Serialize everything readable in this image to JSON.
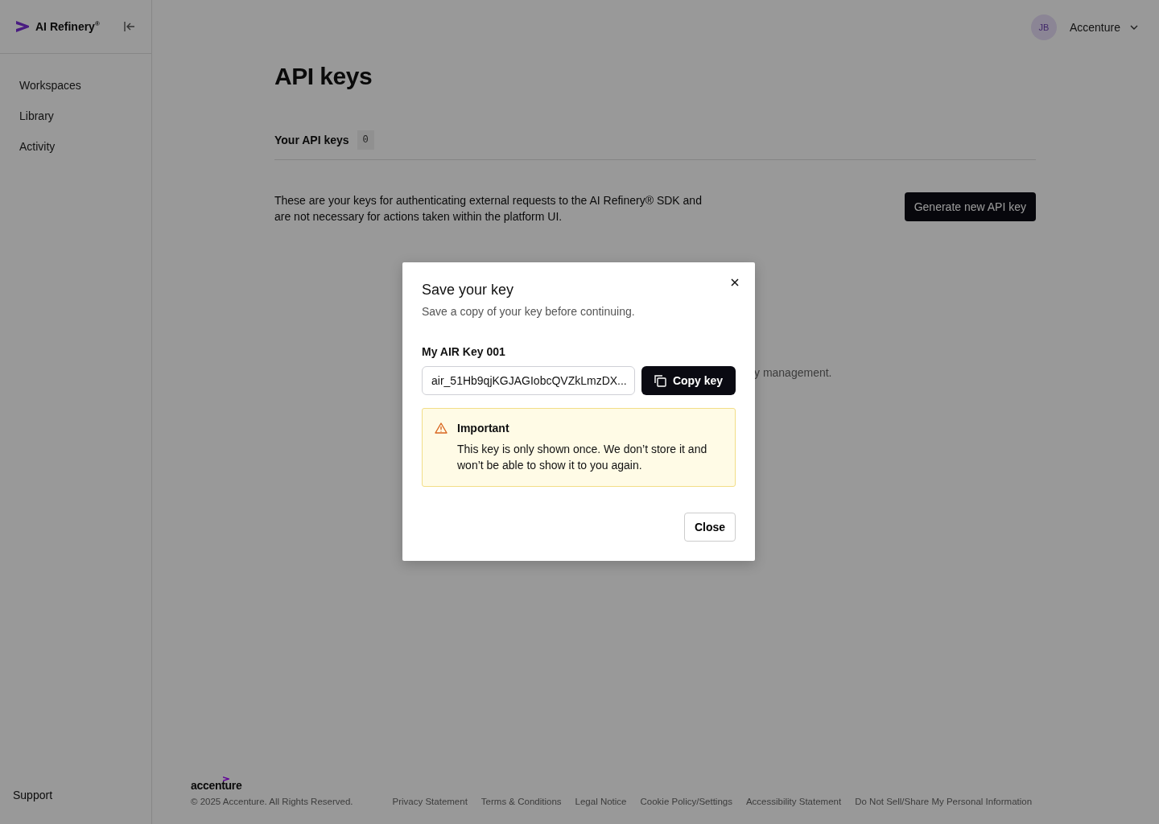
{
  "app": {
    "name": "AI Refinery$^{®}$"
  },
  "sidebar": {
    "items": [
      {
        "label": "Workspaces"
      },
      {
        "label": "Library"
      },
      {
        "label": "Activity"
      }
    ],
    "footer_item": "Support"
  },
  "header": {
    "avatar": "JB",
    "account": "Accenture"
  },
  "page": {
    "title": "API keys",
    "tabs": [
      {
        "label": "Your API keys",
        "count": "0",
        "selected": true
      }
    ],
    "description": "These are your keys for authenticating external requests to the AI Refinery® SDK and are not necessary for actions taken within the platform UI.",
    "generate_button": "Generate new API key",
    "background_text": "y management."
  },
  "modal": {
    "title": "Save your key",
    "subtitle": "Save a copy of your key before continuing.",
    "key_name": "My AIR Key 001",
    "key_value": "air_51Hb9qjKGJAGIobcQVZkLmzDX...",
    "copy_button": "Copy key",
    "notice": {
      "title": "Important",
      "text": "This key is only shown once. We don’t store it and won’t be able to show it to you again."
    },
    "close_button": "Close"
  },
  "footer": {
    "logo": "accenture",
    "copyright": "© 2025 Accenture. All Rights Reserved.",
    "links": [
      "Privacy Statement",
      "Terms & Conditions",
      "Legal Notice",
      "Cookie Policy/Settings",
      "Accessibility Statement",
      "Do Not Sell/Share My Personal Information"
    ]
  }
}
